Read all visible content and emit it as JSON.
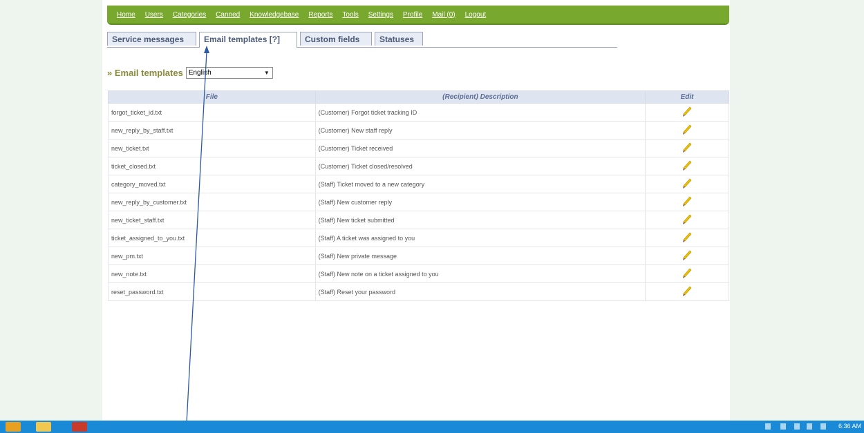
{
  "nav": {
    "items": [
      "Home",
      "Users",
      "Categories",
      "Canned",
      "Knowledgebase",
      "Reports",
      "Tools",
      "Settings",
      "Profile",
      "Mail (0)",
      "Logout"
    ]
  },
  "tabs": [
    {
      "label": "Service messages",
      "active": false
    },
    {
      "label": "Email templates [?]",
      "active": true
    },
    {
      "label": "Custom fields",
      "active": false
    },
    {
      "label": "Statuses",
      "active": false
    }
  ],
  "section": {
    "title": "» Email templates",
    "language": "English"
  },
  "table": {
    "headers": [
      "File",
      "(Recipient) Description",
      "Edit"
    ],
    "rows": [
      {
        "file": "forgot_ticket_id.txt",
        "description": "(Customer) Forgot ticket tracking ID"
      },
      {
        "file": "new_reply_by_staff.txt",
        "description": "(Customer) New staff reply"
      },
      {
        "file": "new_ticket.txt",
        "description": "(Customer) Ticket received"
      },
      {
        "file": "ticket_closed.txt",
        "description": "(Customer) Ticket closed/resolved"
      },
      {
        "file": "category_moved.txt",
        "description": "(Staff) Ticket moved to a new category"
      },
      {
        "file": "new_reply_by_customer.txt",
        "description": "(Staff) New customer reply"
      },
      {
        "file": "new_ticket_staff.txt",
        "description": "(Staff) New ticket submitted"
      },
      {
        "file": "ticket_assigned_to_you.txt",
        "description": "(Staff) A ticket was assigned to you"
      },
      {
        "file": "new_pm.txt",
        "description": "(Staff) New private message"
      },
      {
        "file": "new_note.txt",
        "description": "(Staff) New note on a ticket assigned to you"
      },
      {
        "file": "reset_password.txt",
        "description": "(Staff) Reset your password"
      }
    ]
  },
  "taskbar": {
    "time": "6:36 AM"
  },
  "colors": {
    "nav_bg": "#79a82e",
    "tab_text": "#485a78",
    "header_bg": "#dfe5f0",
    "taskbar": "#1a8ad6",
    "annotation_line": "#2a5aa0"
  }
}
